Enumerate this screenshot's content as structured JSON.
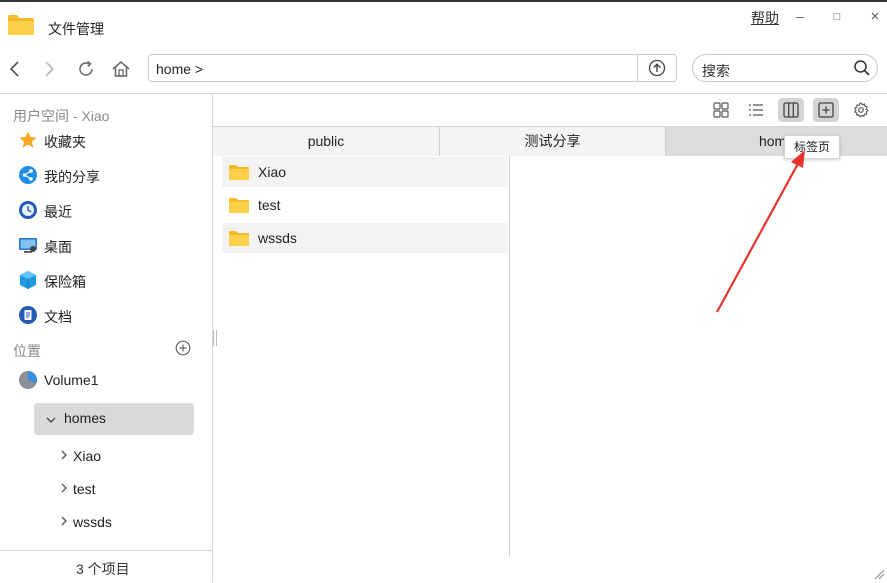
{
  "window": {
    "title": "文件管理",
    "help": "帮助",
    "min": "–",
    "max": "□",
    "close": "×"
  },
  "toolbar": {
    "address": "home >",
    "search_placeholder": "搜索"
  },
  "sidebar": {
    "user_space_header": "用户空间 - Xiao",
    "items": [
      {
        "label": "收藏夹",
        "icon": "star-icon"
      },
      {
        "label": "我的分享",
        "icon": "share-icon"
      },
      {
        "label": "最近",
        "icon": "clock-icon"
      },
      {
        "label": "桌面",
        "icon": "desktop-icon"
      },
      {
        "label": "保险箱",
        "icon": "safe-box-icon"
      },
      {
        "label": "文档",
        "icon": "document-icon"
      }
    ],
    "location_header": "位置",
    "volume": "Volume1",
    "homes": "homes",
    "tree": [
      "Xiao",
      "test",
      "wssds"
    ],
    "footer": "3 个项目"
  },
  "tabs": [
    {
      "label": "public"
    },
    {
      "label": "测试分享"
    },
    {
      "label": "home"
    }
  ],
  "tooltip": "标签页",
  "files": [
    {
      "name": "Xiao"
    },
    {
      "name": "test"
    },
    {
      "name": "wssds"
    }
  ],
  "colors": {
    "folder": "#f8c53a",
    "arrow": "#e8332a",
    "selected": "#d9d9d9"
  }
}
